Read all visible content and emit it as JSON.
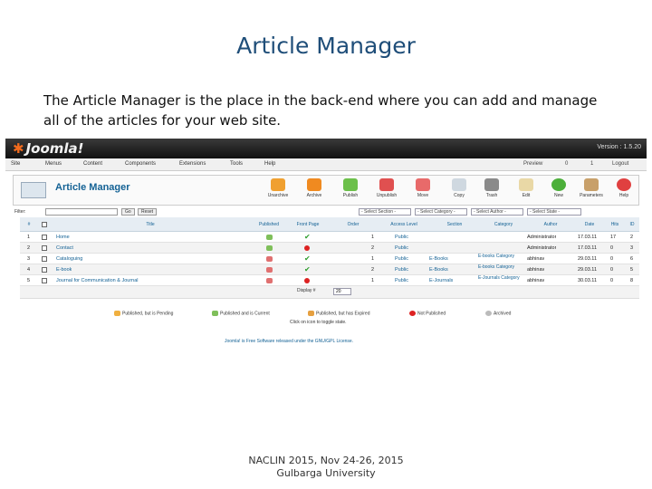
{
  "slide": {
    "title": "Article Manager",
    "description": "The Article Manager is the place in the back-end where you can add and manage all of the articles for your web site.",
    "footer_line1": "NACLIN 2015, Nov 24-26, 2015",
    "footer_line2": "Gulbarga University"
  },
  "app": {
    "logo": "Joomla!",
    "version": "Version : 1.5.20",
    "menu": [
      "Site",
      "Menus",
      "Content",
      "Components",
      "Extensions",
      "Tools",
      "Help"
    ],
    "menu_right": [
      "Preview",
      "0",
      "1",
      "Logout"
    ],
    "page_title": "Article Manager",
    "toolbar": [
      "Unarchive",
      "Archive",
      "Publish",
      "Unpublish",
      "Move",
      "Copy",
      "Trash",
      "Edit",
      "New",
      "Parameters",
      "Help"
    ]
  },
  "filter": {
    "label": "Filter:",
    "go": "Go",
    "reset": "Reset",
    "selects": [
      "- Select Section -",
      "- Select Category -",
      "- Select Author -",
      "- Select State -"
    ]
  },
  "table": {
    "headers": [
      "#",
      "",
      "Title",
      "Published",
      "Front Page",
      "Order",
      "Access Level",
      "Section",
      "Category",
      "Author",
      "Date",
      "Hits",
      "ID"
    ],
    "rows": [
      {
        "num": "1",
        "title": "Home",
        "published": true,
        "front": true,
        "order": "1",
        "access": "Public",
        "section": "",
        "category": "",
        "author": "Administrator",
        "date": "17.03.11",
        "hits": "17",
        "id": "2"
      },
      {
        "num": "2",
        "title": "Contact",
        "published": true,
        "front": false,
        "order": "2",
        "access": "Public",
        "section": "",
        "category": "",
        "author": "Administrator",
        "date": "17.03.11",
        "hits": "0",
        "id": "3"
      },
      {
        "num": "3",
        "title": "Cataloguing",
        "published": false,
        "front": true,
        "order": "1",
        "access": "Public",
        "section": "E-Books",
        "category": "E-books Category",
        "author": "abhinav",
        "date": "29.03.11",
        "hits": "0",
        "id": "6"
      },
      {
        "num": "4",
        "title": "E-book",
        "published": false,
        "front": true,
        "order": "2",
        "access": "Public",
        "section": "E-Books",
        "category": "E-books Category",
        "author": "abhinav",
        "date": "29.03.11",
        "hits": "0",
        "id": "5"
      },
      {
        "num": "5",
        "title": "Journal for Communication & Journal",
        "published": false,
        "front": false,
        "order": "1",
        "access": "Public",
        "section": "E-Journals",
        "category": "E-Journals Category",
        "author": "abhinav",
        "date": "30.03.11",
        "hits": "0",
        "id": "8"
      }
    ],
    "display_label": "Display #",
    "display_value": "20"
  },
  "legend": {
    "items": [
      "Published, but is Pending",
      "Published and is Current",
      "Published, but has Expired",
      "Not Published",
      "Archived"
    ],
    "toggle_note": "Click on icon to toggle state.",
    "powered": "Joomla! is Free Software released under the GNU/GPL License."
  },
  "colors": {
    "accent": "#146295",
    "title": "#1f4e79"
  }
}
